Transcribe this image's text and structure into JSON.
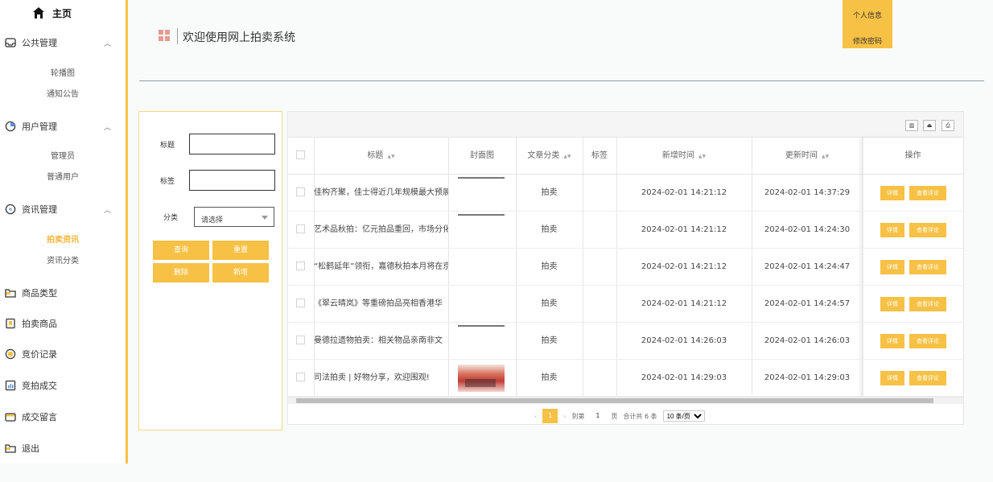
{
  "sidebar": {
    "home": "主页",
    "groups": [
      {
        "label": "公共管理",
        "icon": "inbox-icon"
      },
      {
        "label": "用户管理",
        "icon": "clock-icon"
      },
      {
        "label": "资讯管理",
        "icon": "circle-info-icon"
      }
    ],
    "sub_public": [
      "轮播图",
      "通知公告"
    ],
    "sub_user": [
      "管理员",
      "普通用户"
    ],
    "sub_news": [
      "拍卖资讯",
      "资讯分类"
    ],
    "items": [
      "商品类型",
      "拍卖商品",
      "竞价记录",
      "竞拍成交",
      "成交留言",
      "退出"
    ]
  },
  "header": {
    "title": "欢迎使用网上拍卖系统",
    "user_menu": [
      "个人信息",
      "修改密码"
    ]
  },
  "search": {
    "title_label": "标题",
    "tag_label": "标签",
    "category_label": "分类",
    "category_placeholder": "请选择",
    "buttons": [
      "查询",
      "重置",
      "删除",
      "新增"
    ]
  },
  "table": {
    "headers": [
      "标题",
      "封面图",
      "文章分类",
      "标签",
      "新增时间",
      "更新时间",
      "操作"
    ],
    "rows": [
      {
        "title": "佳构齐聚，佳士得近几年规模最大预展",
        "category": "拍卖",
        "created": "2024-02-01 14:21:12",
        "updated": "2024-02-01 14:37:29",
        "cover": "line"
      },
      {
        "title": "艺术品秋拍：亿元拍品重回，市场分化",
        "category": "拍卖",
        "created": "2024-02-01 14:21:12",
        "updated": "2024-02-01 14:24:30",
        "cover": "line"
      },
      {
        "title": "“松鹤延年”领衔，嘉德秋拍本月将在京",
        "category": "拍卖",
        "created": "2024-02-01 14:21:12",
        "updated": "2024-02-01 14:24:47",
        "cover": "none"
      },
      {
        "title": "《翠云晴岚》等重磅拍品亮相香港华",
        "category": "拍卖",
        "created": "2024-02-01 14:21:12",
        "updated": "2024-02-01 14:24:57",
        "cover": "none"
      },
      {
        "title": "曼德拉遗物拍卖：相关物品亲南非文",
        "category": "拍卖",
        "created": "2024-02-01 14:26:03",
        "updated": "2024-02-01 14:26:03",
        "cover": "line"
      },
      {
        "title": "司法拍卖 | 好物分享，欢迎围观!",
        "category": "拍卖",
        "created": "2024-02-01 14:29:03",
        "updated": "2024-02-01 14:29:03",
        "cover": "image"
      }
    ],
    "row_buttons": [
      "详情",
      "查看评论"
    ],
    "toolbar_icons": [
      "columns-icon",
      "export-icon",
      "print-icon"
    ]
  },
  "pager": {
    "current": "1",
    "goto_label": "到第",
    "goto_value": "1",
    "page_unit": "页",
    "total": "合计共 6 条",
    "page_size": "10 条/页"
  },
  "colors": {
    "accent": "#f7c145",
    "sidebar_border": "#f7c145",
    "logo": "#e79a8f"
  }
}
